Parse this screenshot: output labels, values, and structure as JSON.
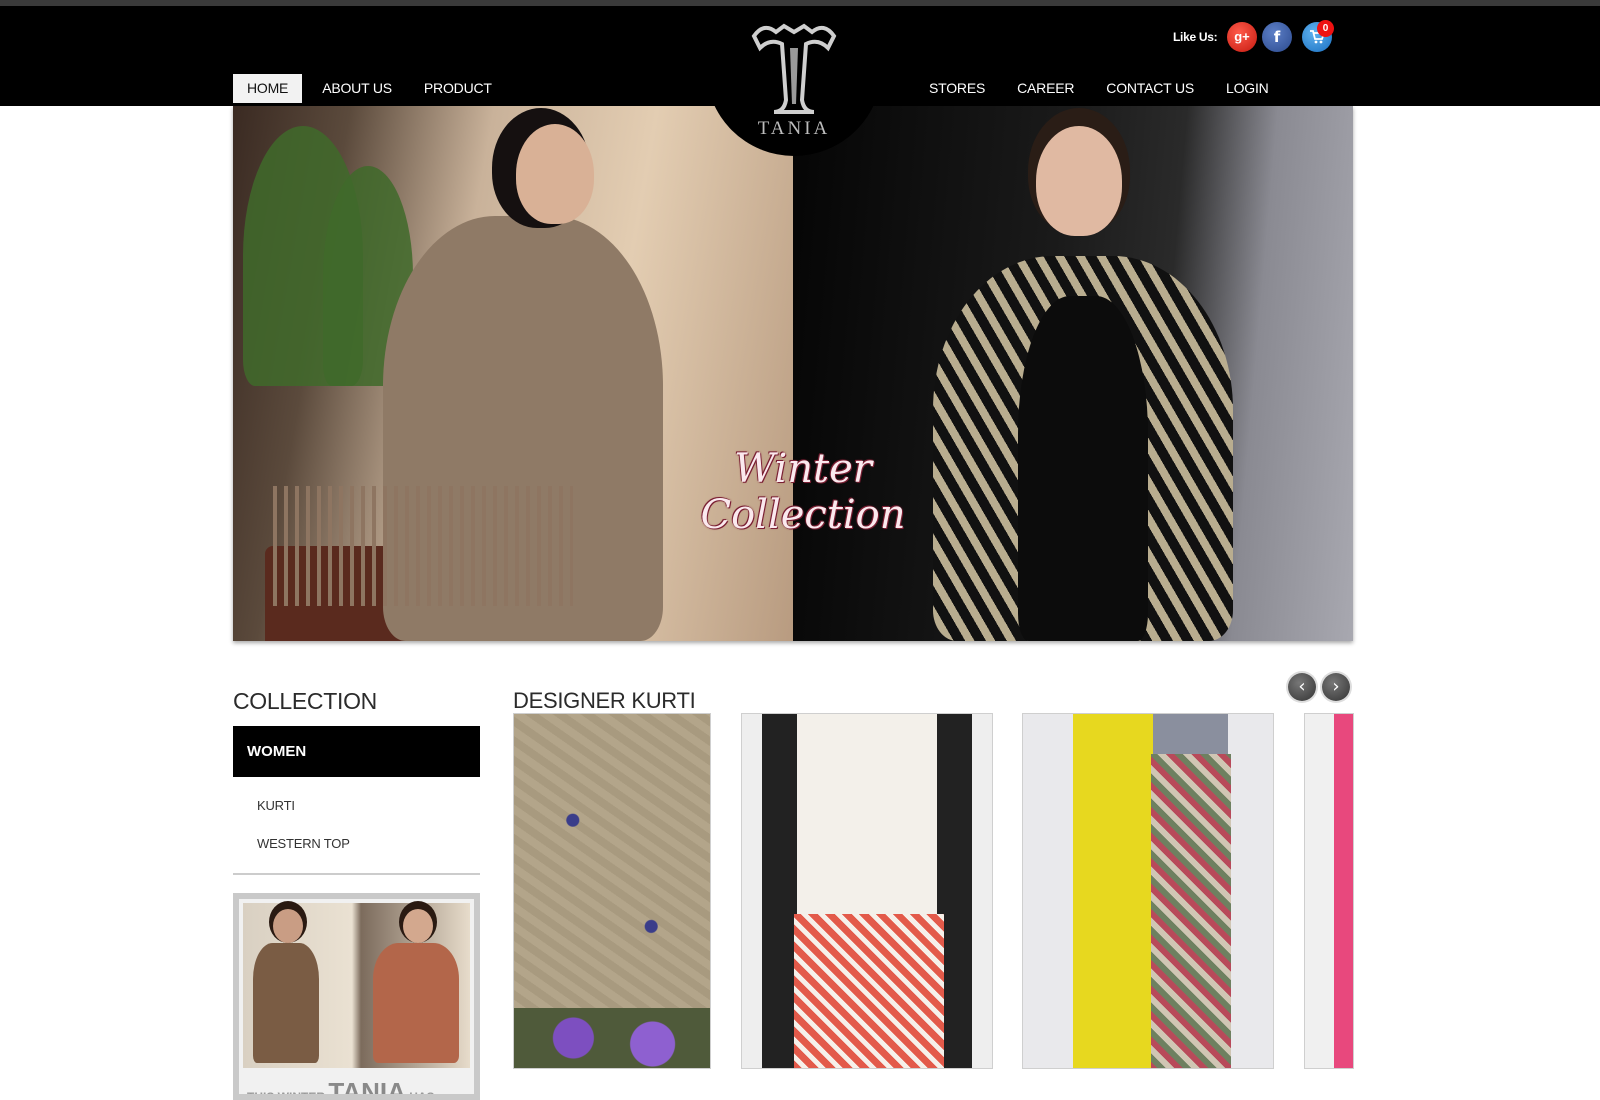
{
  "brand": {
    "name": "TANIA",
    "monogram": "T"
  },
  "nav": {
    "left": [
      "HOME",
      "ABOUT US",
      "PRODUCT"
    ],
    "right": [
      "STORES",
      "CAREER",
      "CONTACT US",
      "LOGIN"
    ],
    "active": "HOME"
  },
  "social": {
    "like_label": "Like Us:",
    "gplus_label": "g+",
    "facebook_label": "f",
    "cart_count": "0",
    "icons": [
      "google-plus-icon",
      "facebook-icon",
      "cart-icon"
    ]
  },
  "hero": {
    "title_line1": "Winter",
    "title_line2": "Collection"
  },
  "sidebar": {
    "title": "COLLECTION",
    "category": "WOMEN",
    "items": [
      "KURTI",
      "WESTERN TOP"
    ],
    "promo": {
      "prefix": "THIS WINTER",
      "brand": "TANIA",
      "suffix": "HAS"
    }
  },
  "carousel": {
    "title": "DESIGNER KURTI",
    "prev_glyph": "‹",
    "next_glyph": "›"
  },
  "colors": {
    "header": "#000000",
    "accent_red": "#e11111",
    "active_tab": "#f2f2f2"
  }
}
